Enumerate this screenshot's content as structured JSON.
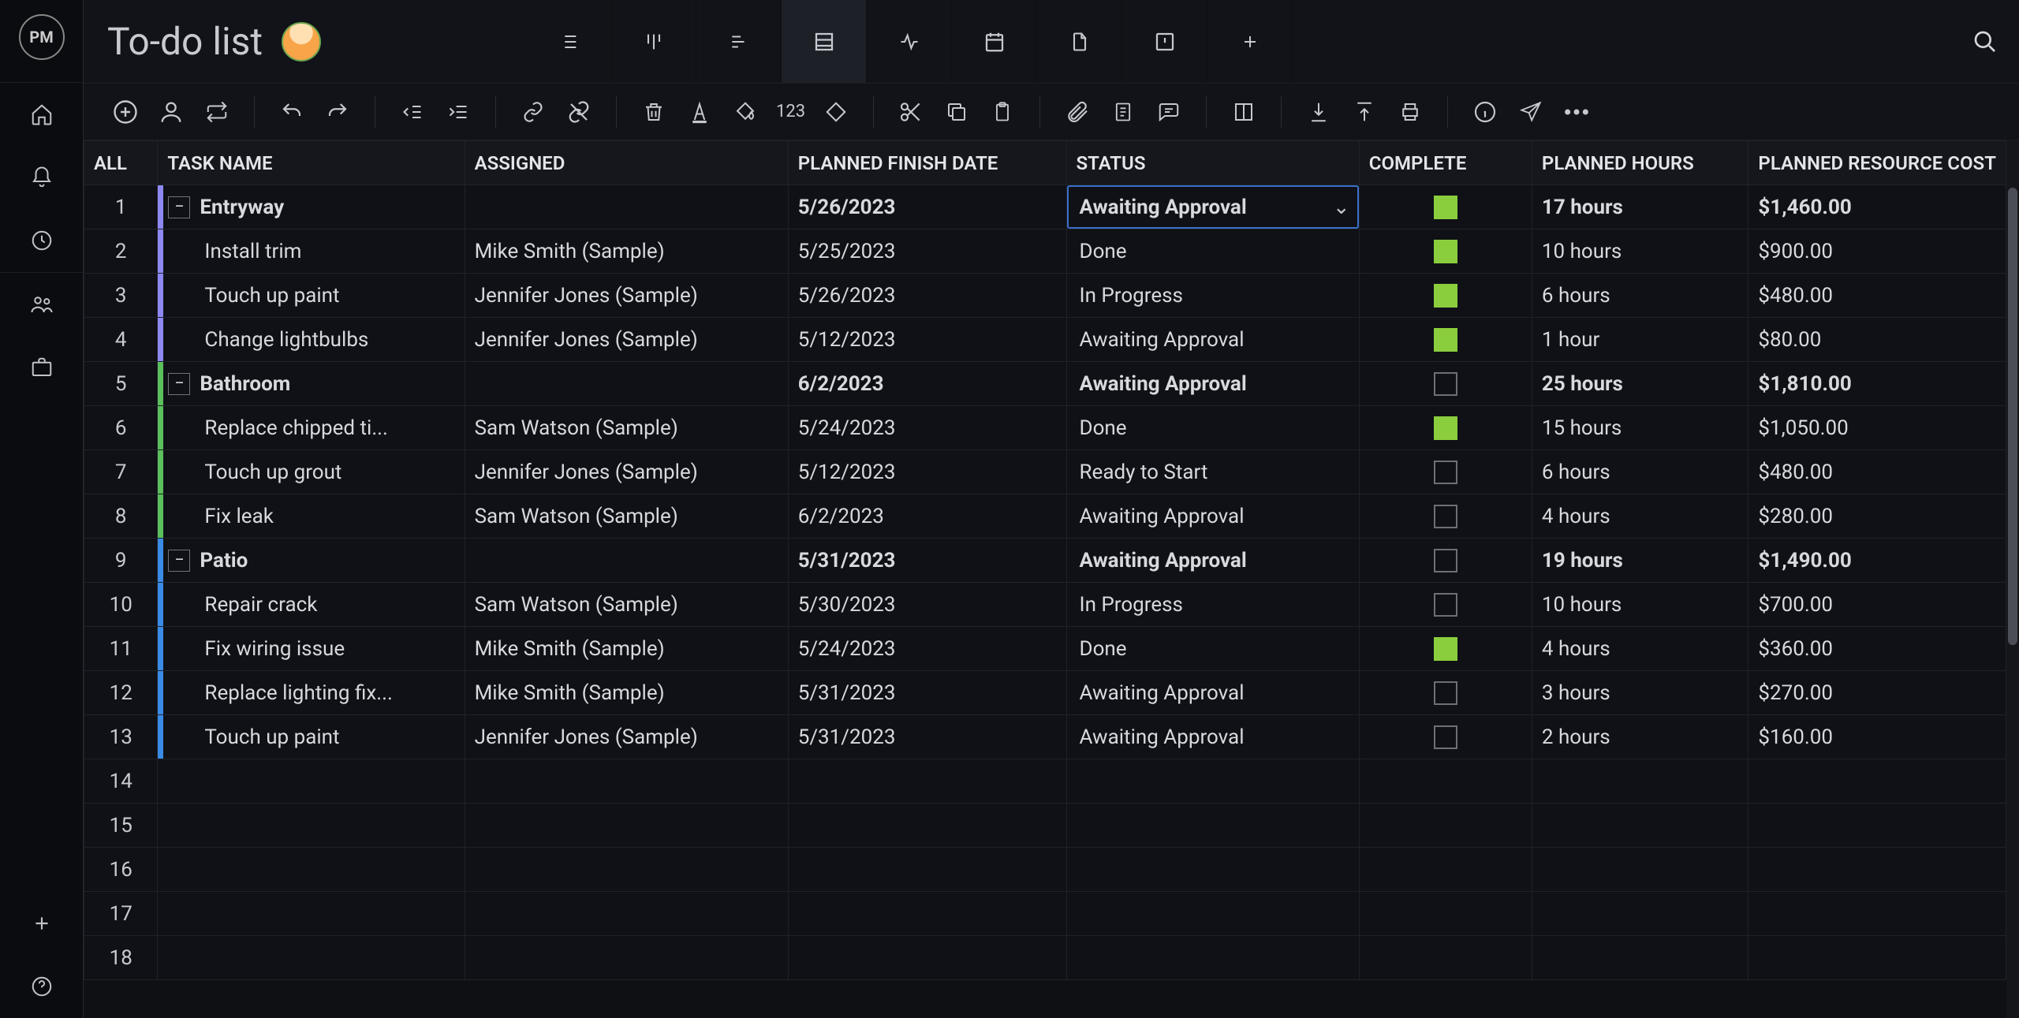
{
  "title": "To-do list",
  "columns": {
    "all": "ALL",
    "name": "TASK NAME",
    "assigned": "ASSIGNED",
    "date": "PLANNED FINISH DATE",
    "status": "STATUS",
    "complete": "COMPLETE",
    "hours": "PLANNED HOURS",
    "cost": "PLANNED RESOURCE COST"
  },
  "toolbar": {
    "numeric": "123"
  },
  "colors": {
    "hier": {
      "purple": "#8e89f2",
      "green": "#5bbf5b",
      "blue": "#3b8be6"
    }
  },
  "rows": [
    {
      "n": "1",
      "type": "parent",
      "color": "purple",
      "name": "Entryway",
      "assigned": "",
      "date": "5/26/2023",
      "status": "Awaiting Approval",
      "status_editing": true,
      "complete": true,
      "hours": "17 hours",
      "cost": "$1,460.00"
    },
    {
      "n": "2",
      "type": "child",
      "color": "purple",
      "name": "Install trim",
      "assigned": "Mike Smith (Sample)",
      "date": "5/25/2023",
      "status": "Done",
      "complete": true,
      "hours": "10 hours",
      "cost": "$900.00"
    },
    {
      "n": "3",
      "type": "child",
      "color": "purple",
      "name": "Touch up paint",
      "assigned": "Jennifer Jones (Sample)",
      "date": "5/26/2023",
      "status": "In Progress",
      "complete": true,
      "hours": "6 hours",
      "cost": "$480.00"
    },
    {
      "n": "4",
      "type": "child",
      "color": "purple",
      "name": "Change lightbulbs",
      "assigned": "Jennifer Jones (Sample)",
      "date": "5/12/2023",
      "status": "Awaiting Approval",
      "complete": true,
      "hours": "1 hour",
      "cost": "$80.00"
    },
    {
      "n": "5",
      "type": "parent",
      "color": "green",
      "name": "Bathroom",
      "assigned": "",
      "date": "6/2/2023",
      "status": "Awaiting Approval",
      "complete": false,
      "hours": "25 hours",
      "cost": "$1,810.00"
    },
    {
      "n": "6",
      "type": "child",
      "color": "green",
      "name": "Replace chipped ti...",
      "assigned": "Sam Watson (Sample)",
      "date": "5/24/2023",
      "status": "Done",
      "complete": true,
      "hours": "15 hours",
      "cost": "$1,050.00"
    },
    {
      "n": "7",
      "type": "child",
      "color": "green",
      "name": "Touch up grout",
      "assigned": "Jennifer Jones (Sample)",
      "date": "5/12/2023",
      "status": "Ready to Start",
      "complete": false,
      "hours": "6 hours",
      "cost": "$480.00"
    },
    {
      "n": "8",
      "type": "child",
      "color": "green",
      "name": "Fix leak",
      "assigned": "Sam Watson (Sample)",
      "date": "6/2/2023",
      "status": "Awaiting Approval",
      "complete": false,
      "hours": "4 hours",
      "cost": "$280.00"
    },
    {
      "n": "9",
      "type": "parent",
      "color": "blue",
      "name": "Patio",
      "assigned": "",
      "date": "5/31/2023",
      "status": "Awaiting Approval",
      "complete": false,
      "hours": "19 hours",
      "cost": "$1,490.00"
    },
    {
      "n": "10",
      "type": "child",
      "color": "blue",
      "name": "Repair crack",
      "assigned": "Sam Watson (Sample)",
      "date": "5/30/2023",
      "status": "In Progress",
      "complete": false,
      "hours": "10 hours",
      "cost": "$700.00"
    },
    {
      "n": "11",
      "type": "child",
      "color": "blue",
      "name": "Fix wiring issue",
      "assigned": "Mike Smith (Sample)",
      "date": "5/24/2023",
      "status": "Done",
      "complete": true,
      "hours": "4 hours",
      "cost": "$360.00"
    },
    {
      "n": "12",
      "type": "child",
      "color": "blue",
      "name": "Replace lighting fix...",
      "assigned": "Mike Smith (Sample)",
      "date": "5/31/2023",
      "status": "Awaiting Approval",
      "complete": false,
      "hours": "3 hours",
      "cost": "$270.00"
    },
    {
      "n": "13",
      "type": "child",
      "color": "blue",
      "name": "Touch up paint",
      "assigned": "Jennifer Jones (Sample)",
      "date": "5/31/2023",
      "status": "Awaiting Approval",
      "complete": false,
      "hours": "2 hours",
      "cost": "$160.00"
    }
  ],
  "empty_rows": [
    "14",
    "15",
    "16",
    "17",
    "18"
  ]
}
